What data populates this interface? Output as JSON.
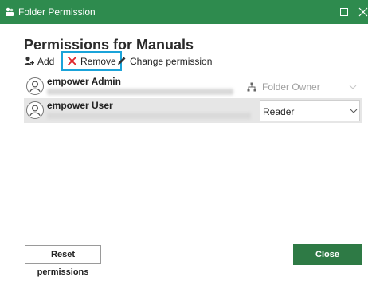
{
  "window": {
    "title": "Folder Permission",
    "accent_color": "#2e8b4e",
    "icons": {
      "app": "folder-people-icon",
      "maximize": "maximize-icon",
      "close": "close-icon"
    }
  },
  "heading": "Permissions for Manuals",
  "toolbar": {
    "add_label": "Add",
    "remove_label": "Remove",
    "change_label": "Change permission",
    "remove_color": "#e0262b",
    "focus_color": "#1aa3d9"
  },
  "users": [
    {
      "name": "empower Admin",
      "email": "",
      "permission": "Folder Owner",
      "editable": false
    },
    {
      "name": "empower User",
      "email": "",
      "permission": "Reader",
      "editable": true
    }
  ],
  "footer": {
    "reset_label": "Reset permissions",
    "close_label": "Close",
    "close_color": "#2e7a45"
  }
}
